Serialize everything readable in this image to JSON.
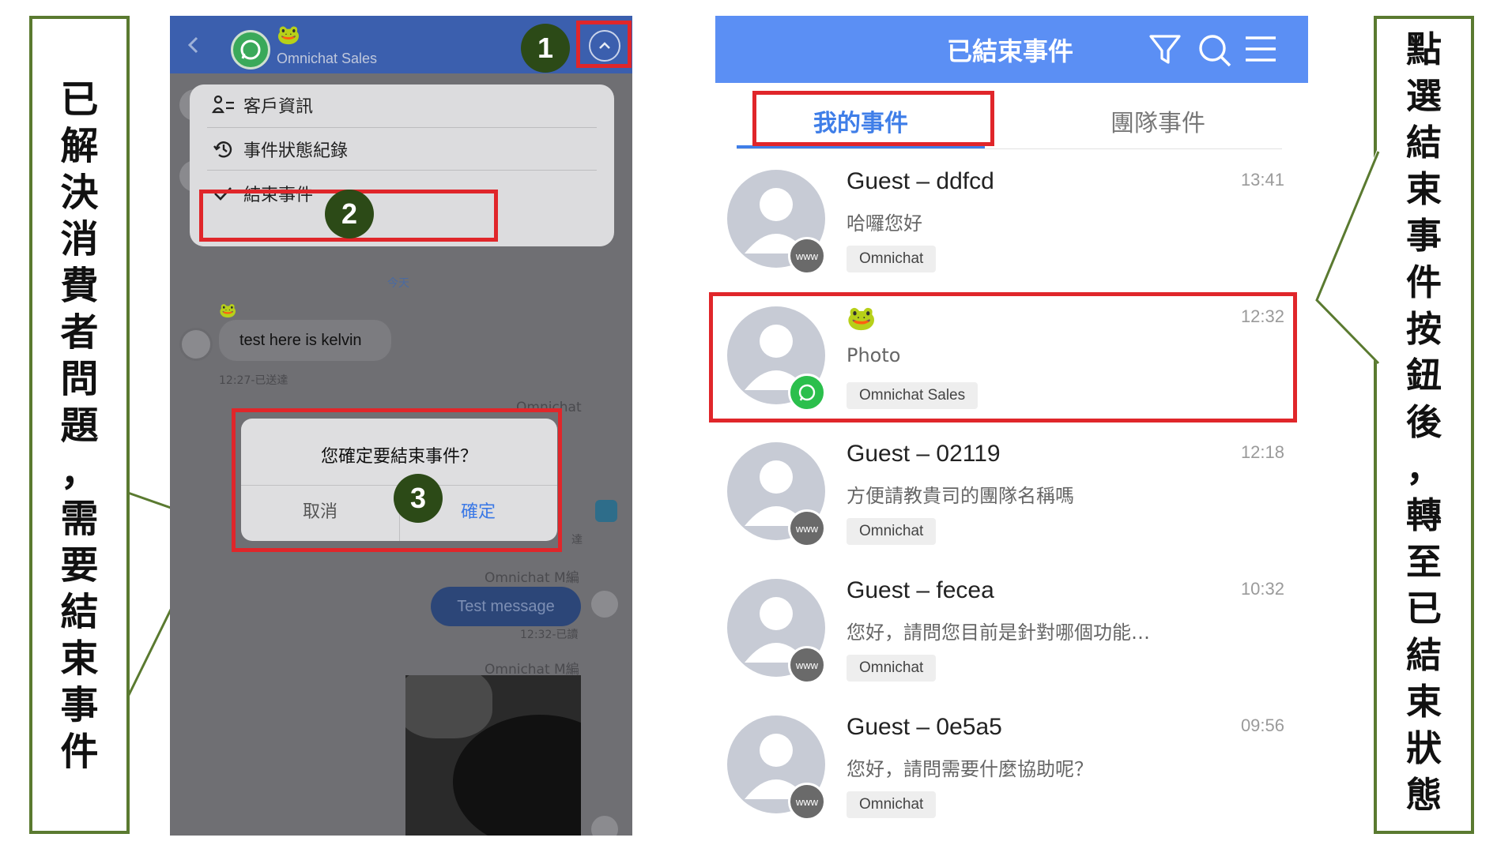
{
  "left_callout": {
    "chars": [
      "已",
      "解",
      "決",
      "消",
      "費",
      "者",
      "問",
      "題",
      "，",
      "需",
      "要",
      "結",
      "束",
      "事",
      "件"
    ]
  },
  "right_callout": {
    "chars": [
      "點",
      "選",
      "結",
      "束",
      "事",
      "件",
      "按",
      "鈕",
      "後",
      "，",
      "轉",
      "至",
      "已",
      "結",
      "束",
      "狀",
      "態"
    ]
  },
  "colors": {
    "callout_border": "#5a7a30",
    "highlight_red": "#e0262a",
    "step_badge": "#2c4a17",
    "chat_header": "#3b5fae",
    "list_header": "#5b8ff4",
    "whatsapp_green": "#2bbf4c"
  },
  "chat_screen": {
    "header": {
      "back_icon": "chevron-left-icon",
      "channel_icon": "whatsapp-icon",
      "contact_emoji": "🐸",
      "contact_name": "Omnichat Sales",
      "expand_icon": "chevron-up-circle-icon"
    },
    "menu": {
      "items": [
        {
          "icon": "user-list-icon",
          "label": "客戶資訊"
        },
        {
          "icon": "history-icon",
          "label": "事件狀態紀錄"
        },
        {
          "icon": "check-icon",
          "label": "結束事件"
        }
      ]
    },
    "date_divider": "今天",
    "messages": [
      {
        "sender_emoji": "🐸",
        "text": "test here is kelvin",
        "meta": "12:27-已送達"
      },
      {
        "sender": "Omnichat"
      },
      {
        "sender": "Omnichat M編",
        "text": "Test message",
        "meta": "12:32-已讀"
      },
      {
        "sender": "Omnichat M編"
      }
    ],
    "partial_status": "達",
    "dialog": {
      "title": "您確定要結束事件？",
      "cancel": "取消",
      "confirm": "確定"
    },
    "steps": [
      "1",
      "2",
      "3"
    ]
  },
  "list_screen": {
    "title": "已結束事件",
    "header_icons": [
      "filter-icon",
      "search-icon",
      "menu-icon"
    ],
    "tabs": [
      {
        "label": "我的事件",
        "active": true
      },
      {
        "label": "團隊事件",
        "active": false
      }
    ],
    "items": [
      {
        "name": "Guest – ddfcd",
        "preview": "哈囉您好",
        "tag": "Omnichat",
        "time": "13:41",
        "channel": "www"
      },
      {
        "name": "🐸",
        "preview": "Photo",
        "tag": "Omnichat Sales",
        "time": "12:32",
        "channel": "whatsapp"
      },
      {
        "name": "Guest – 02119",
        "preview": "方便請教貴司的團隊名稱嗎",
        "tag": "Omnichat",
        "time": "12:18",
        "channel": "www"
      },
      {
        "name": "Guest – fecea",
        "preview": "您好，請問您目前是針對哪個功能…",
        "tag": "Omnichat",
        "time": "10:32",
        "channel": "www"
      },
      {
        "name": "Guest – 0e5a5",
        "preview": "您好，請問需要什麼協助呢？",
        "tag": "Omnichat",
        "time": "09:56",
        "channel": "www"
      }
    ]
  }
}
